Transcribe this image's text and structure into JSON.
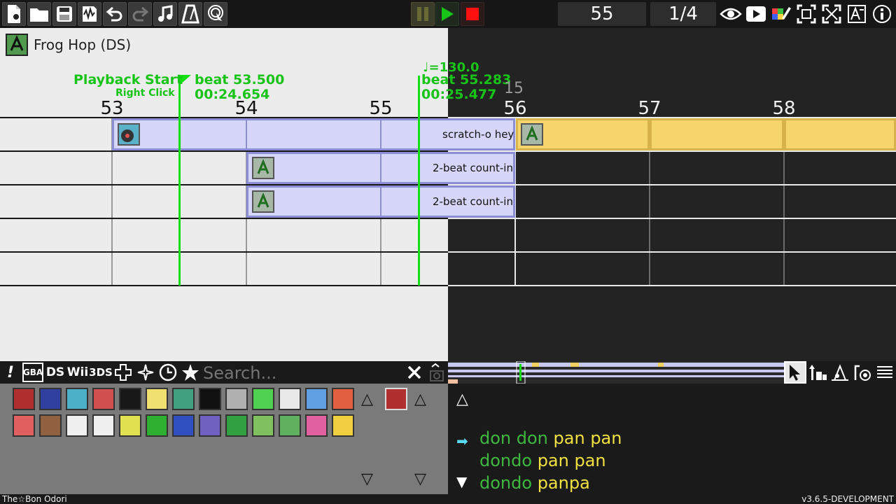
{
  "toolbar": {
    "tempo_value": "55",
    "snap_value": "1/4"
  },
  "game": {
    "title": "Frog Hop (DS)"
  },
  "timeline": {
    "beats": [
      "53",
      "54",
      "55",
      "56",
      "57",
      "58"
    ],
    "playback_start": {
      "label": "Playback Start",
      "hint": "Right Click",
      "beat": "beat 53.500",
      "time": "00:24.654"
    },
    "cursor": {
      "tempo": "♩=130.0",
      "beat": "beat 55.283",
      "time": "00:25.477",
      "measure": "15"
    },
    "blocks": {
      "row1_label": "scratch-o hey",
      "row2_label": "2-beat count-in",
      "row3_label": "2-beat count-in"
    }
  },
  "palette": {
    "tabs": [
      "!",
      "GBA",
      "DS",
      "Wii",
      "3DS"
    ],
    "search_placeholder": "Search..."
  },
  "lyrics": {
    "lines": [
      {
        "part1": "don don",
        "part2": "pan pan"
      },
      {
        "part1": "dondo",
        "part2": "pan pan"
      },
      {
        "part1": "dondo",
        "part2": "panpa"
      }
    ]
  },
  "footer": {
    "selected_game": "The☆Bon Odori",
    "version": "v3.6.5-DEVELOPMENT"
  },
  "colors": {
    "accent_green": "#12e012",
    "block_fill": "#d6d6fa",
    "block_border": "#8e8ed6",
    "highlight_yellow": "#f6d66c"
  }
}
